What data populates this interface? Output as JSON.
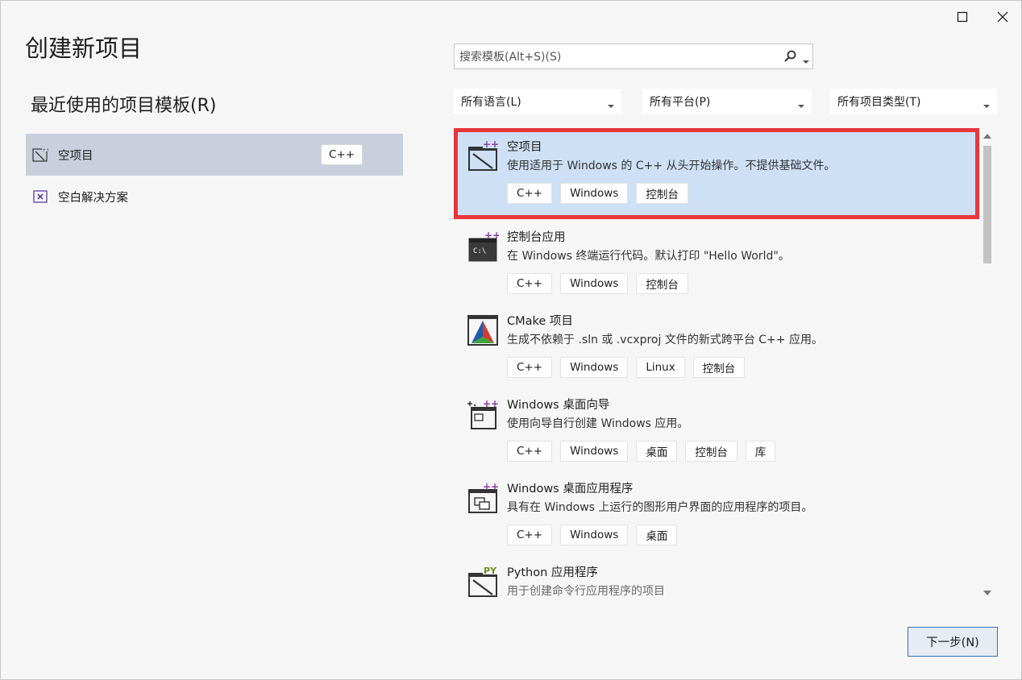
{
  "window": {
    "maximize_icon": "square-outline",
    "close_icon": "x-cross"
  },
  "header": {
    "title": "创建新项目"
  },
  "recent": {
    "title": "最近使用的项目模板(R)",
    "items": [
      {
        "label": "空项目",
        "tag": "C++",
        "icon": "empty-project-icon",
        "selected": true
      },
      {
        "label": "空白解决方案",
        "tag": "",
        "icon": "vs-solution-icon",
        "selected": false
      }
    ]
  },
  "search": {
    "placeholder": "搜索模板(Alt+S)(S)"
  },
  "filters": {
    "language": "所有语言(L)",
    "platform": "所有平台(P)",
    "project_type": "所有项目类型(T)"
  },
  "templates": [
    {
      "name": "空项目",
      "description": "使用适用于 Windows 的 C++ 从头开始操作。不提供基础文件。",
      "tags": [
        "C++",
        "Windows",
        "控制台"
      ],
      "selected": true
    },
    {
      "name": "控制台应用",
      "description": "在 Windows 终端运行代码。默认打印 \"Hello World\"。",
      "tags": [
        "C++",
        "Windows",
        "控制台"
      ],
      "selected": false
    },
    {
      "name": "CMake 项目",
      "description": "生成不依赖于 .sln 或 .vcxproj 文件的新式跨平台 C++ 应用。",
      "tags": [
        "C++",
        "Windows",
        "Linux",
        "控制台"
      ],
      "selected": false
    },
    {
      "name": "Windows 桌面向导",
      "description": "使用向导自行创建 Windows 应用。",
      "tags": [
        "C++",
        "Windows",
        "桌面",
        "控制台",
        "库"
      ],
      "selected": false
    },
    {
      "name": "Windows 桌面应用程序",
      "description": "具有在 Windows 上运行的图形用户界面的应用程序的项目。",
      "tags": [
        "C++",
        "Windows",
        "桌面"
      ],
      "selected": false
    },
    {
      "name": "Python 应用程序",
      "description": "用于创建命令行应用程序的项目",
      "tags": [],
      "selected": false
    }
  ],
  "footer": {
    "next_label": "下一步(N)"
  },
  "colors": {
    "selection_border": "#e8363d",
    "selection_bg": "#cde0f5",
    "recent_selected_bg": "#c9cfdc",
    "accent": "#3f6eb5"
  }
}
